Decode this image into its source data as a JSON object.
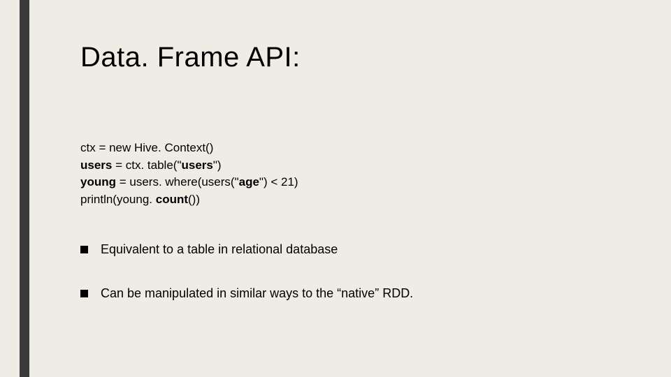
{
  "slide": {
    "title": "Data. Frame API:",
    "code": {
      "line1_pre": "ctx = new Hive. Context()",
      "line2_bold": "users",
      "line2_mid": " = ctx. table(\"",
      "line2_bold2": "users",
      "line2_end": "\")",
      "line3_bold": "young",
      "line3_mid": " = users. where(users(\"",
      "line3_bold2": "age",
      "line3_end": "\") < 21)",
      "line4_pre": "println(young. ",
      "line4_bold": "count",
      "line4_end": "())"
    },
    "bullets": [
      "Equivalent to a table in relational database",
      "Can be manipulated in similar ways to the “native” RDD."
    ]
  }
}
